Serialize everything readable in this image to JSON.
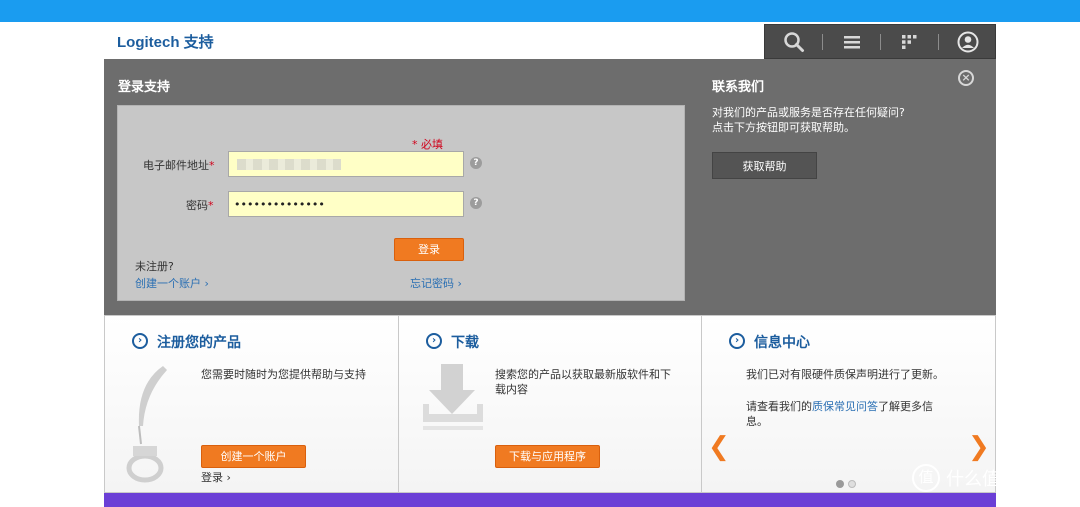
{
  "header": {
    "logo": "Logitech 支持"
  },
  "login": {
    "title": "登录支持",
    "required_note": "* 必填",
    "email_label": "电子邮件地址",
    "password_label": "密码",
    "password_value": "••••••••••••••",
    "login_button": "登录",
    "not_registered": "未注册?",
    "create_account_link": "创建一个账户",
    "forgot_password_link": "忘记密码"
  },
  "contact": {
    "title": "联系我们",
    "text_line1": "对我们的产品或服务是否存在任何疑问?",
    "text_line2": "点击下方按钮即可获取帮助。",
    "help_button": "获取帮助"
  },
  "panels": [
    {
      "title": "注册您的产品",
      "text": "您需要时随时为您提供帮助与支持",
      "button": "创建一个账户",
      "link": "登录"
    },
    {
      "title": "下载",
      "text": "搜索您的产品以获取最新版软件和下载内容",
      "button": "下载与应用程序"
    },
    {
      "title": "信息中心",
      "text": "我们已对有限硬件质保声明进行了更新。",
      "text2_prefix": "请查看我们的",
      "text2_link": "质保常见问答",
      "text2_suffix": "了解更多信息。"
    }
  ],
  "watermark": {
    "text": "什么值得买",
    "symbol": "值"
  },
  "colors": {
    "accent_orange": "#f07a21",
    "brand_blue": "#1c5d9e",
    "top_bar": "#1a9cf0",
    "bottom_bar": "#6b3fd6"
  },
  "icons": [
    "search-icon",
    "menu-icon",
    "apps-grid-icon",
    "user-icon",
    "close-icon",
    "help-icon",
    "chevron-right-icon",
    "feather-pen-icon",
    "download-icon",
    "arrow-left-icon",
    "arrow-right-icon"
  ]
}
